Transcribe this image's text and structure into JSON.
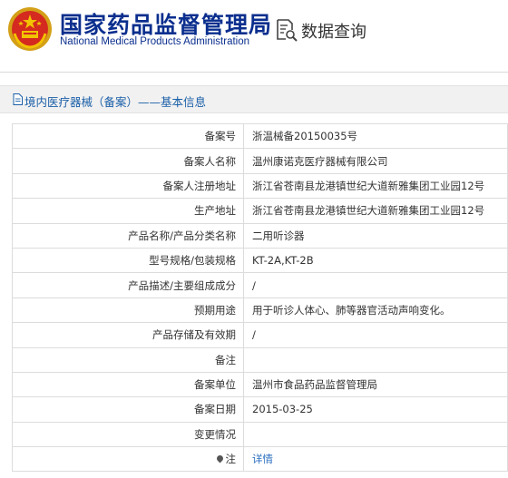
{
  "header": {
    "title_cn": "国家药品监督管理局",
    "title_en": "National Medical Products Administration",
    "query_label": "数据查询",
    "icons": {
      "emblem": "national-emblem-icon",
      "query": "document-search-icon"
    }
  },
  "section": {
    "title": "境内医疗器械（备案）——基本信息",
    "icon": "document-icon"
  },
  "colors": {
    "brand": "#0b2f8e",
    "link": "#2c6fc0",
    "section_title": "#1a5fa8"
  },
  "rows": [
    {
      "label": "备案号",
      "value": "浙温械备20150035号"
    },
    {
      "label": "备案人名称",
      "value": "温州康诺克医疗器械有限公司"
    },
    {
      "label": "备案人注册地址",
      "value": "浙江省苍南县龙港镇世纪大道新雅集团工业园12号"
    },
    {
      "label": "生产地址",
      "value": "浙江省苍南县龙港镇世纪大道新雅集团工业园12号"
    },
    {
      "label": "产品名称/产品分类名称",
      "value": "二用听诊器"
    },
    {
      "label": "型号规格/包装规格",
      "value": "KT-2A,KT-2B"
    },
    {
      "label": "产品描述/主要组成成分",
      "value": "/"
    },
    {
      "label": "预期用途",
      "value": "用于听诊人体心、肺等器官活动声响变化。"
    },
    {
      "label": "产品存储及有效期",
      "value": "/"
    },
    {
      "label": "备注",
      "value": ""
    },
    {
      "label": "备案单位",
      "value": "温州市食品药品监督管理局"
    },
    {
      "label": "备案日期",
      "value": "2015-03-25"
    },
    {
      "label": "变更情况",
      "value": ""
    },
    {
      "label": "注",
      "value": "详情",
      "icon": "map-pin-icon"
    }
  ]
}
